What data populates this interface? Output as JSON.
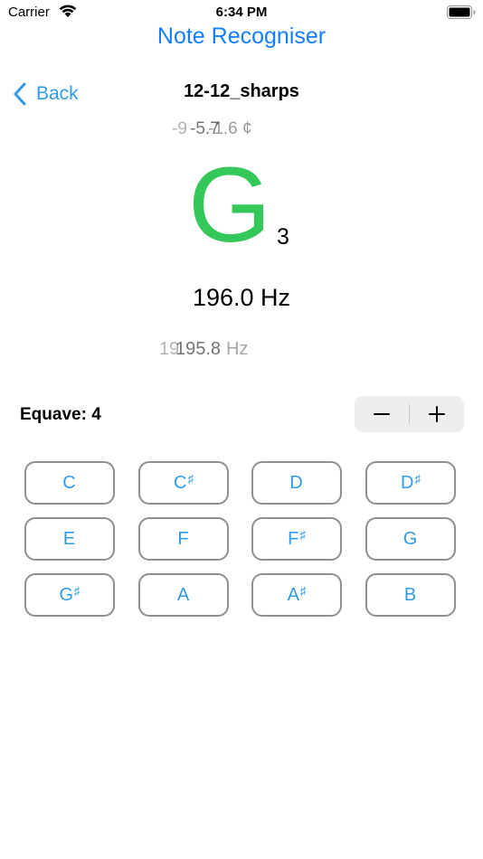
{
  "status_bar": {
    "carrier": "Carrier",
    "time": "6:34 PM",
    "wifi_icon": "wifi-icon",
    "battery_icon": "battery-icon"
  },
  "app_title": "Note Recogniser",
  "nav": {
    "back_label": "Back",
    "title": "12-12_sharps",
    "back_icon": "chevron-left-icon"
  },
  "cents_readings": [
    "-9",
    "-5.7",
    "-1.6 ¢"
  ],
  "note": {
    "letter": "G",
    "octave": "3",
    "color": "#34c759"
  },
  "frequency": "196.0 Hz",
  "frequency_readings": [
    "19",
    "195.8",
    "Hz"
  ],
  "equave": {
    "label": "Equave: 4",
    "decrement_icon": "minus-icon",
    "increment_icon": "plus-icon"
  },
  "note_buttons": [
    {
      "name": "C",
      "acc": ""
    },
    {
      "name": "C",
      "acc": "♯"
    },
    {
      "name": "D",
      "acc": ""
    },
    {
      "name": "D",
      "acc": "♯"
    },
    {
      "name": "E",
      "acc": ""
    },
    {
      "name": "F",
      "acc": ""
    },
    {
      "name": "F",
      "acc": "♯"
    },
    {
      "name": "G",
      "acc": ""
    },
    {
      "name": "G",
      "acc": "♯"
    },
    {
      "name": "A",
      "acc": ""
    },
    {
      "name": "A",
      "acc": "♯"
    },
    {
      "name": "B",
      "acc": ""
    }
  ],
  "colors": {
    "accent": "#147efb",
    "button_text": "#2e9ce6",
    "note_green": "#34c759"
  }
}
